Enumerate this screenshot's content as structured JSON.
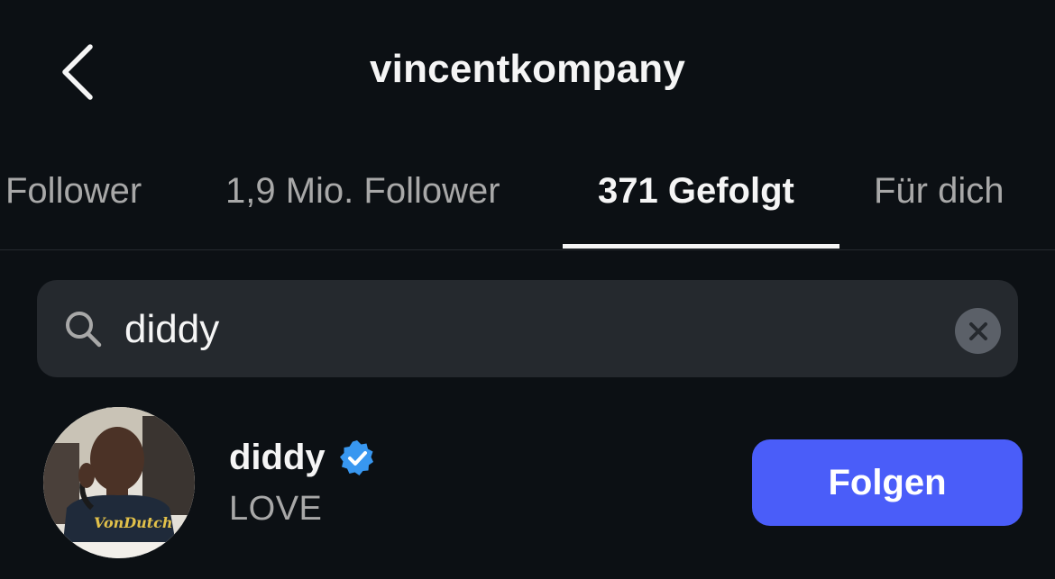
{
  "header": {
    "title": "vincentkompany",
    "back_icon": "chevron-left-icon"
  },
  "tabs": [
    {
      "label": "Follower",
      "active": false
    },
    {
      "label": "1,9 Mio. Follower",
      "active": false
    },
    {
      "label": "371 Gefolgt",
      "active": true
    },
    {
      "label": "Für dich",
      "active": false
    }
  ],
  "search": {
    "value": "diddy",
    "icon": "search-icon",
    "clear_icon": "clear-icon"
  },
  "result": {
    "username": "diddy",
    "verified": true,
    "full_name": "LOVE",
    "follow_label": "Folgen",
    "avatar_shirt_text": "VonDutch"
  },
  "colors": {
    "background": "#0c1014",
    "search_bg": "#25292e",
    "follow_button": "#4a5df9",
    "verified_badge": "#3897f0",
    "muted_text": "#a8a8a8"
  }
}
